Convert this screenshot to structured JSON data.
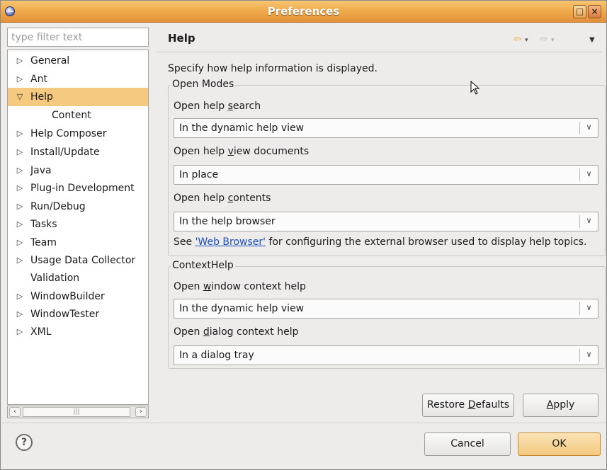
{
  "window": {
    "title": "Preferences"
  },
  "sidebar": {
    "filter_placeholder": "type filter text",
    "items": [
      {
        "label": "General",
        "arrow": "▷"
      },
      {
        "label": "Ant",
        "arrow": "▷"
      },
      {
        "label": "Help",
        "arrow": "▽",
        "selected": true
      },
      {
        "label": "Content",
        "arrow": ""
      },
      {
        "label": "Help Composer",
        "arrow": "▷"
      },
      {
        "label": "Install/Update",
        "arrow": "▷"
      },
      {
        "label": "Java",
        "arrow": "▷"
      },
      {
        "label": "Plug-in Development",
        "arrow": "▷"
      },
      {
        "label": "Run/Debug",
        "arrow": "▷"
      },
      {
        "label": "Tasks",
        "arrow": "▷"
      },
      {
        "label": "Team",
        "arrow": "▷"
      },
      {
        "label": "Usage Data Collector",
        "arrow": "▷"
      },
      {
        "label": "Validation",
        "arrow": ""
      },
      {
        "label": "WindowBuilder",
        "arrow": "▷"
      },
      {
        "label": "WindowTester",
        "arrow": "▷"
      },
      {
        "label": "XML",
        "arrow": "▷"
      }
    ]
  },
  "page": {
    "title": "Help",
    "description": "Specify how help information is displayed.",
    "open_modes": {
      "title": "Open Modes",
      "search_label_pre": "Open help ",
      "search_label_mn": "s",
      "search_label_post": "earch",
      "search_value": "In the dynamic help view",
      "view_docs_label_pre": "Open help ",
      "view_docs_label_mn": "v",
      "view_docs_label_post": "iew documents",
      "view_docs_value": "In place",
      "contents_label_pre": "Open help ",
      "contents_label_mn": "c",
      "contents_label_post": "ontents",
      "contents_value": "In the help browser",
      "link_prefix": "See ",
      "link_text": "'Web Browser'",
      "link_suffix": " for configuring the external browser used to display help topics."
    },
    "context_help": {
      "title": "ContextHelp",
      "window_label_pre": "Open ",
      "window_label_mn": "w",
      "window_label_post": "indow context help",
      "window_value": "In the dynamic help view",
      "dialog_label_pre": "Open ",
      "dialog_label_mn": "d",
      "dialog_label_post": "ialog context help",
      "dialog_value": "In a dialog tray"
    },
    "restore_pre": "Restore ",
    "restore_mn": "D",
    "restore_post": "efaults",
    "apply_mn": "A",
    "apply_post": "pply"
  },
  "footer": {
    "help_glyph": "?",
    "cancel_label": "Cancel",
    "ok_label": "OK"
  }
}
